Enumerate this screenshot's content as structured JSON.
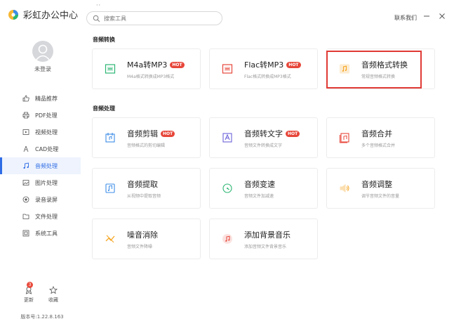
{
  "app": {
    "title": "彩虹办公中心"
  },
  "search": {
    "placeholder": "搜索工具"
  },
  "header": {
    "contact": "联系我们",
    "minimize": "—",
    "close": "✕"
  },
  "user": {
    "login_text": "未登录"
  },
  "sidebar": {
    "items": [
      {
        "label": "精品推荐",
        "icon": "thumbs-up-icon"
      },
      {
        "label": "PDF处理",
        "icon": "printer-icon"
      },
      {
        "label": "视频处理",
        "icon": "video-icon"
      },
      {
        "label": "CAD处理",
        "icon": "cad-icon"
      },
      {
        "label": "音频处理",
        "icon": "music-note-icon",
        "active": true
      },
      {
        "label": "图片处理",
        "icon": "image-icon"
      },
      {
        "label": "录音录屏",
        "icon": "record-icon"
      },
      {
        "label": "文件处理",
        "icon": "folder-icon"
      },
      {
        "label": "系统工具",
        "icon": "toolbox-icon"
      }
    ],
    "update_label": "更新",
    "update_badge": "3",
    "favorite_label": "收藏",
    "version": "版本号:1.22.8.163"
  },
  "sections": {
    "convert": {
      "title": "音频转换",
      "cards": [
        {
          "title": "M4a转MP3",
          "hot": "HOT",
          "desc": "M4a格式转换成MP3格式",
          "icon": "m4a-convert-icon",
          "color": "#2bb673"
        },
        {
          "title": "Flac转MP3",
          "hot": "HOT",
          "desc": "Flac格式转换成MP3格式",
          "icon": "flac-convert-icon",
          "color": "#e7463a"
        },
        {
          "title": "音频格式转换",
          "hot": "",
          "desc": "常规音频格式转换",
          "icon": "audio-format-icon",
          "color": "#f5a623"
        }
      ]
    },
    "process": {
      "title": "音频处理",
      "cards": [
        {
          "title": "音频剪辑",
          "hot": "HOT",
          "desc": "音频格式的剪切编辑",
          "icon": "audio-cut-icon",
          "color": "#3c8ce7"
        },
        {
          "title": "音频转文字",
          "hot": "HOT",
          "desc": "音频文件转换成文字",
          "icon": "audio-to-text-icon",
          "color": "#6c63d9"
        },
        {
          "title": "音频合并",
          "hot": "",
          "desc": "多个音频格式合并",
          "icon": "audio-merge-icon",
          "color": "#e7463a"
        },
        {
          "title": "音频提取",
          "hot": "",
          "desc": "从视频中提取音频",
          "icon": "audio-extract-icon",
          "color": "#3c8ce7"
        },
        {
          "title": "音频变速",
          "hot": "",
          "desc": "音频文件加减速",
          "icon": "audio-speed-icon",
          "color": "#2bb673"
        },
        {
          "title": "音频调整",
          "hot": "",
          "desc": "调节音频文件的音量",
          "icon": "audio-volume-icon",
          "color": "#f5a623"
        },
        {
          "title": "噪音消除",
          "hot": "",
          "desc": "音频文件降噪",
          "icon": "noise-remove-icon",
          "color": "#f5a623"
        },
        {
          "title": "添加背景音乐",
          "hot": "",
          "desc": "添加音频文件背景音乐",
          "icon": "background-music-icon",
          "color": "#e7463a"
        }
      ]
    }
  },
  "accent_color": "#2f6ce5",
  "highlight_color": "#e03a35"
}
